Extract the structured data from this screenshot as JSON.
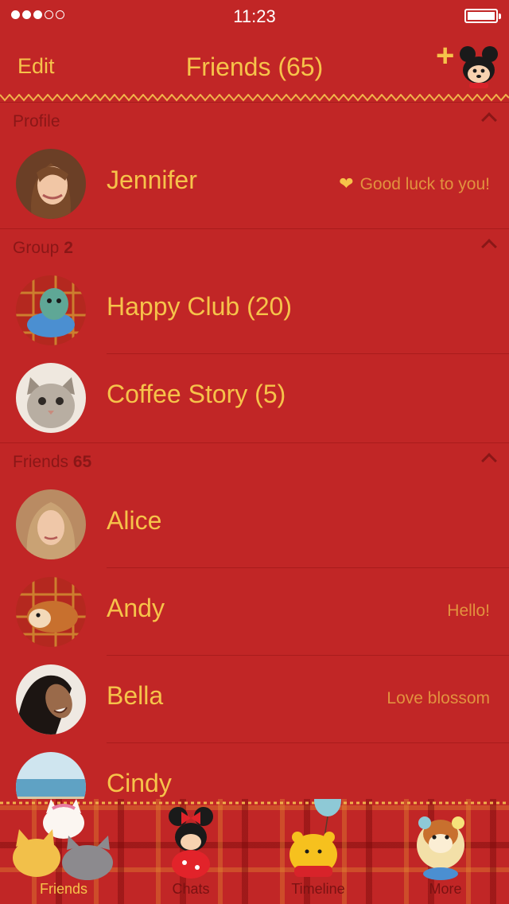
{
  "status_bar": {
    "time": "11:23"
  },
  "nav": {
    "edit_label": "Edit",
    "title": "Friends (65)",
    "add_label": "+"
  },
  "sections": {
    "profile": {
      "label": "Profile"
    },
    "group": {
      "label": "Group",
      "count": "2"
    },
    "friends": {
      "label": "Friends",
      "count": "65"
    }
  },
  "profile": {
    "name": "Jennifer",
    "status": "Good luck to you!"
  },
  "groups": [
    {
      "name": "Happy Club (20)"
    },
    {
      "name": "Coffee Story (5)"
    }
  ],
  "friends": [
    {
      "name": "Alice",
      "status": ""
    },
    {
      "name": "Andy",
      "status": "Hello!"
    },
    {
      "name": "Bella",
      "status": "Love blossom"
    },
    {
      "name": "Cindy",
      "status": ""
    }
  ],
  "tabs": [
    {
      "label": "Friends",
      "icon": "cats-sticker-icon",
      "active": true
    },
    {
      "label": "Chats",
      "icon": "minnie-sticker-icon",
      "active": false
    },
    {
      "label": "Timeline",
      "icon": "pooh-balloon-sticker-icon",
      "active": false
    },
    {
      "label": "More",
      "icon": "chip-chipmunk-sticker-icon",
      "active": false
    }
  ],
  "colors": {
    "background": "#c12626",
    "accent": "#f6c34a",
    "header_text": "#8a1717",
    "status_text": "#e2923e"
  }
}
